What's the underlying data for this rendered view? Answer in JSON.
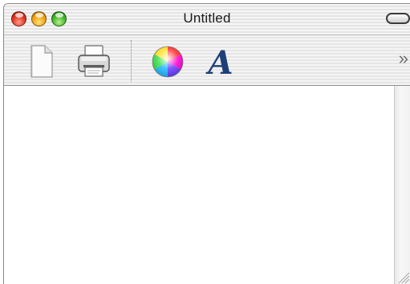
{
  "window": {
    "title": "Untitled"
  },
  "titlebar": {
    "buttons": [
      {
        "name": "close",
        "color": "#e0321f"
      },
      {
        "name": "minimize",
        "color": "#f0a010"
      },
      {
        "name": "zoom",
        "color": "#3fb32a"
      }
    ],
    "toolbar_toggle_icon": "pill-toggle-icon"
  },
  "toolbar": {
    "items": [
      {
        "icon": "new-document-icon"
      },
      {
        "icon": "printer-icon"
      },
      {
        "icon": "color-wheel-icon"
      },
      {
        "icon": "font-icon",
        "glyph": "A"
      }
    ],
    "overflow_glyph": "»"
  },
  "document": {
    "text": ""
  }
}
